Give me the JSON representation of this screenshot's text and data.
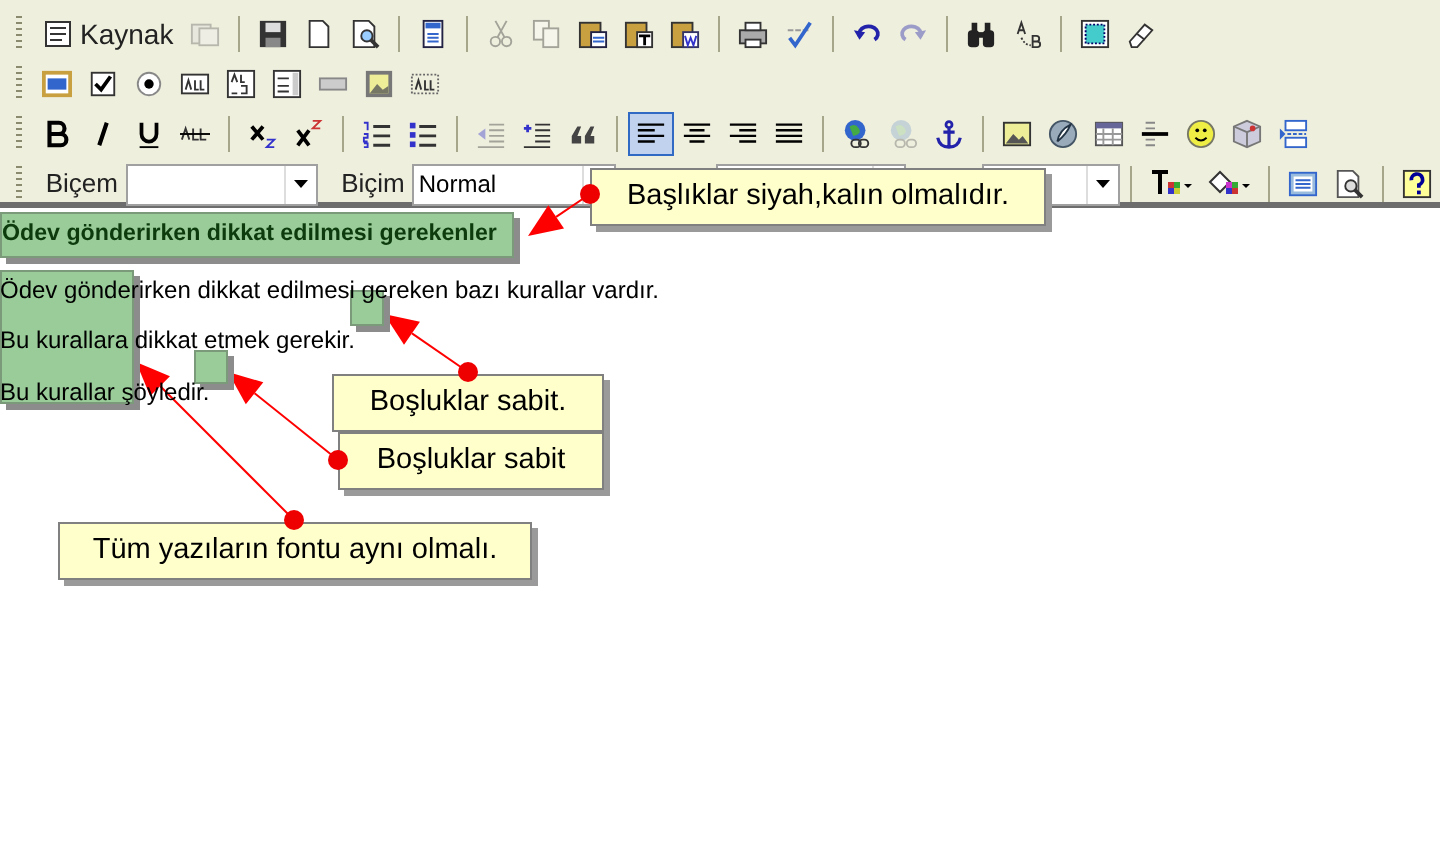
{
  "toolbar": {
    "rows": [
      {
        "items": [
          {
            "kind": "text-button",
            "label": "Kaynak",
            "disabled": false
          },
          {
            "kind": "icon",
            "disabled": true
          },
          {
            "kind": "icon",
            "disabled": false
          },
          {
            "kind": "icon",
            "disabled": false
          },
          {
            "kind": "icon",
            "disabled": false
          },
          {
            "kind": "icon",
            "disabled": false
          },
          {
            "kind": "icon",
            "disabled": true
          },
          {
            "kind": "icon",
            "disabled": true
          },
          {
            "kind": "icon",
            "disabled": false
          },
          {
            "kind": "icon",
            "disabled": false
          },
          {
            "kind": "icon",
            "disabled": false
          },
          {
            "kind": "icon",
            "disabled": false
          },
          {
            "kind": "icon",
            "disabled": false
          },
          {
            "kind": "icon",
            "disabled": false
          },
          {
            "kind": "icon",
            "disabled": true
          },
          {
            "kind": "icon",
            "disabled": false
          },
          {
            "kind": "icon",
            "disabled": false
          },
          {
            "kind": "icon",
            "disabled": false
          },
          {
            "kind": "icon",
            "disabled": false
          }
        ]
      },
      {
        "items": [
          {
            "kind": "icon",
            "disabled": false
          },
          {
            "kind": "icon",
            "disabled": false
          },
          {
            "kind": "icon",
            "disabled": false
          },
          {
            "kind": "icon",
            "disabled": false
          },
          {
            "kind": "icon",
            "disabled": false
          },
          {
            "kind": "icon",
            "disabled": false
          },
          {
            "kind": "icon",
            "disabled": false
          },
          {
            "kind": "icon",
            "disabled": false
          },
          {
            "kind": "icon",
            "disabled": false
          }
        ]
      },
      {
        "items": [
          {
            "kind": "icon",
            "disabled": false,
            "selected": false
          },
          {
            "kind": "icon",
            "disabled": false,
            "selected": false
          },
          {
            "kind": "icon",
            "disabled": false,
            "selected": false
          },
          {
            "kind": "icon",
            "disabled": false,
            "selected": false
          },
          {
            "kind": "icon",
            "disabled": false,
            "selected": false
          },
          {
            "kind": "icon",
            "disabled": false,
            "selected": false
          },
          {
            "kind": "icon",
            "disabled": false,
            "selected": false
          },
          {
            "kind": "icon",
            "disabled": false,
            "selected": false
          },
          {
            "kind": "icon",
            "disabled": true,
            "selected": false
          },
          {
            "kind": "icon",
            "disabled": false,
            "selected": false
          },
          {
            "kind": "icon",
            "disabled": false,
            "selected": false
          },
          {
            "kind": "icon",
            "disabled": false,
            "selected": true
          },
          {
            "kind": "icon",
            "disabled": false,
            "selected": false
          },
          {
            "kind": "icon",
            "disabled": false,
            "selected": false
          },
          {
            "kind": "icon",
            "disabled": false,
            "selected": false
          },
          {
            "kind": "icon",
            "disabled": false,
            "selected": false
          },
          {
            "kind": "icon",
            "disabled": true,
            "selected": false
          },
          {
            "kind": "icon",
            "disabled": false,
            "selected": false
          },
          {
            "kind": "icon",
            "disabled": false,
            "selected": false
          },
          {
            "kind": "icon",
            "disabled": false,
            "selected": false
          },
          {
            "kind": "icon",
            "disabled": false,
            "selected": false
          },
          {
            "kind": "icon",
            "disabled": false,
            "selected": false
          },
          {
            "kind": "icon",
            "disabled": false,
            "selected": false
          },
          {
            "kind": "icon",
            "disabled": false,
            "selected": false
          },
          {
            "kind": "icon",
            "disabled": false,
            "selected": false
          }
        ]
      },
      {
        "items": [
          {
            "kind": "combo",
            "label": "Biçem"
          },
          {
            "kind": "combo",
            "label": "Biçim",
            "value": "Normal"
          },
          {
            "kind": "combo"
          },
          {
            "kind": "combo"
          },
          {
            "kind": "icon",
            "disabled": false
          },
          {
            "kind": "icon",
            "disabled": false
          },
          {
            "kind": "icon",
            "disabled": false
          },
          {
            "kind": "icon",
            "disabled": false
          },
          {
            "kind": "icon",
            "disabled": false
          }
        ]
      }
    ]
  },
  "document": {
    "heading": "Ödev gönderirken dikkat edilmesi gerekenler",
    "paragraphs": [
      "Ödev gönderirken dikkat edilmesi gereken bazı kurallar vardır.",
      "Bu kurallara dikkat etmek gerekir.",
      "Bu kurallar şöyledir."
    ]
  },
  "annotations": [
    {
      "text": "Başlıklar siyah,kalın olmalıdır."
    },
    {
      "text": "Boşluklar sabit."
    },
    {
      "text": "Boşluklar sabit"
    },
    {
      "text": "Tüm yazıların fontu aynı olmalı."
    }
  ]
}
